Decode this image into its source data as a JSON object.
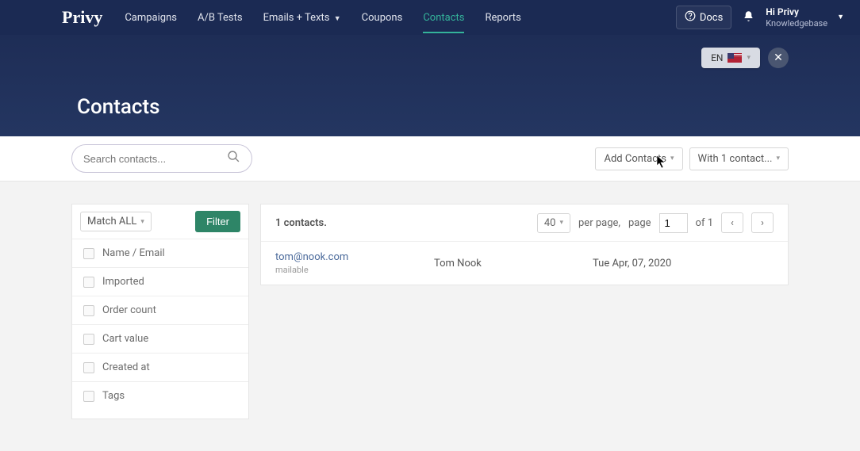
{
  "brand": "Privy",
  "nav": {
    "items": [
      {
        "label": "Campaigns"
      },
      {
        "label": "A/B Tests"
      },
      {
        "label": "Emails + Texts",
        "caret": true
      },
      {
        "label": "Coupons"
      },
      {
        "label": "Contacts",
        "active": true
      },
      {
        "label": "Reports"
      }
    ]
  },
  "topbar": {
    "docs_label": "Docs",
    "greeting": "Hi Privy",
    "greeting_sub": "Knowledgebase"
  },
  "lang": {
    "label": "EN"
  },
  "page_title": "Contacts",
  "search": {
    "placeholder": "Search contacts..."
  },
  "toolbar": {
    "add_contacts": "Add Contacts",
    "bulk_action": "With 1 contact..."
  },
  "filter": {
    "match_label": "Match ALL",
    "filter_button": "Filter",
    "rows": [
      {
        "label": "Name / Email"
      },
      {
        "label": "Imported"
      },
      {
        "label": "Order count"
      },
      {
        "label": "Cart value"
      },
      {
        "label": "Created at"
      },
      {
        "label": "Tags"
      }
    ]
  },
  "results": {
    "count_text": "1 contacts.",
    "per_page_value": "40",
    "per_page_label": "per page,",
    "page_label": "page",
    "page_value": "1",
    "of_label": "of 1"
  },
  "contacts": [
    {
      "email": "tom@nook.com",
      "status": "mailable",
      "name": "Tom Nook",
      "date": "Tue Apr, 07, 2020"
    }
  ]
}
